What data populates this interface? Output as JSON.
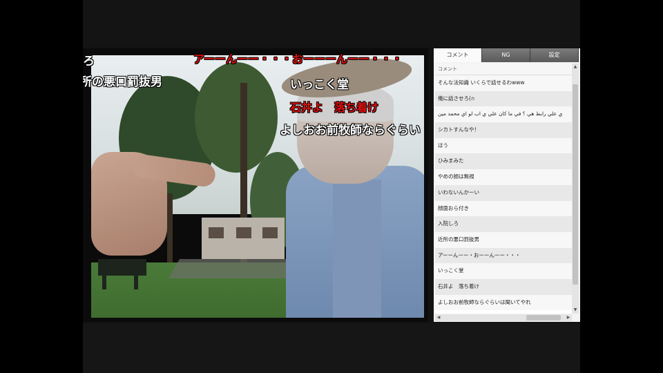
{
  "video": {
    "overlay_comments": [
      {
        "text": "ろ",
        "color": "#ffffff"
      },
      {
        "text": "所の悪口罰抜男",
        "color": "#ffffff"
      },
      {
        "text": "アーーんーー・・・おーーーんーー・・・",
        "color": "#e01010"
      },
      {
        "text": "いっこく堂",
        "color": "#ffffff"
      },
      {
        "text": "石井よ　落ち着け",
        "color": "#e01010"
      },
      {
        "text": "よしおお前牧師ならぐらい",
        "color": "#ffffff"
      }
    ]
  },
  "panel": {
    "tabs": [
      {
        "label": "コメント",
        "active": true
      },
      {
        "label": "NG",
        "active": false
      },
      {
        "label": "設定",
        "active": false
      }
    ],
    "list_header": "コメント",
    "comments": [
      "そんな法知識 いくらで話せるわwww",
      "俺に話させろ(∩",
      "ي علي رابط هي ؟ في ما كان علي ي اب لو اي محمد مين",
      "シカトすんなや！",
      "ほう",
      "ひみまみた",
      "やめの顔は無視",
      "いわないんかーい",
      "顔面おら付き",
      "入院しろ",
      "近所の悪口罰抜男",
      "アーーんーー・おーーんーー・・・",
      "いっこく堂",
      "石井よ　落ち着け",
      "よしおお前牧師ならぐらいは聞いてやれ"
    ]
  }
}
